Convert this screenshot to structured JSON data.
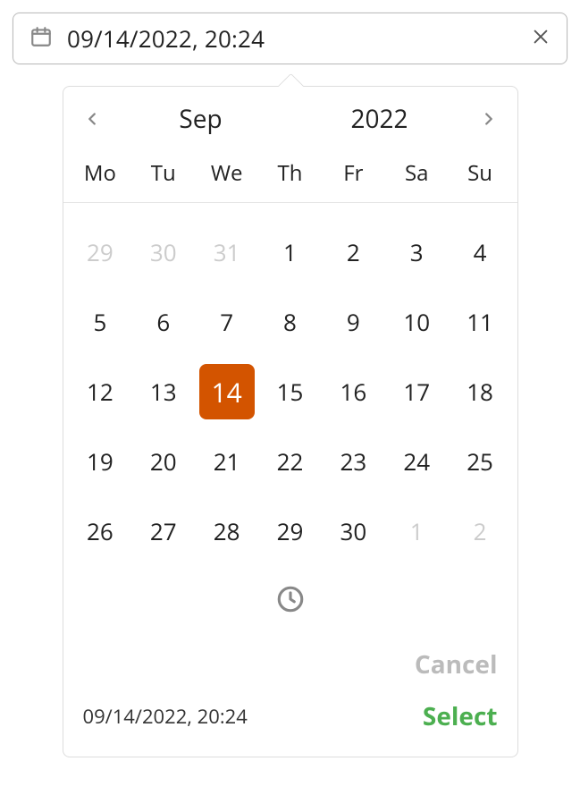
{
  "input": {
    "value": "09/14/2022, 20:24"
  },
  "header": {
    "month": "Sep",
    "year": "2022"
  },
  "weekdays": [
    "Mo",
    "Tu",
    "We",
    "Th",
    "Fr",
    "Sa",
    "Su"
  ],
  "days": [
    {
      "n": "29",
      "out": true
    },
    {
      "n": "30",
      "out": true
    },
    {
      "n": "31",
      "out": true
    },
    {
      "n": "1"
    },
    {
      "n": "2"
    },
    {
      "n": "3"
    },
    {
      "n": "4"
    },
    {
      "n": "5"
    },
    {
      "n": "6"
    },
    {
      "n": "7"
    },
    {
      "n": "8"
    },
    {
      "n": "9"
    },
    {
      "n": "10"
    },
    {
      "n": "11"
    },
    {
      "n": "12"
    },
    {
      "n": "13"
    },
    {
      "n": "14",
      "sel": true
    },
    {
      "n": "15"
    },
    {
      "n": "16"
    },
    {
      "n": "17"
    },
    {
      "n": "18"
    },
    {
      "n": "19"
    },
    {
      "n": "20"
    },
    {
      "n": "21"
    },
    {
      "n": "22"
    },
    {
      "n": "23"
    },
    {
      "n": "24"
    },
    {
      "n": "25"
    },
    {
      "n": "26"
    },
    {
      "n": "27"
    },
    {
      "n": "28"
    },
    {
      "n": "29"
    },
    {
      "n": "30"
    },
    {
      "n": "1",
      "out": true
    },
    {
      "n": "2",
      "out": true
    }
  ],
  "footer": {
    "selected": "09/14/2022, 20:24",
    "cancel": "Cancel",
    "select": "Select"
  }
}
